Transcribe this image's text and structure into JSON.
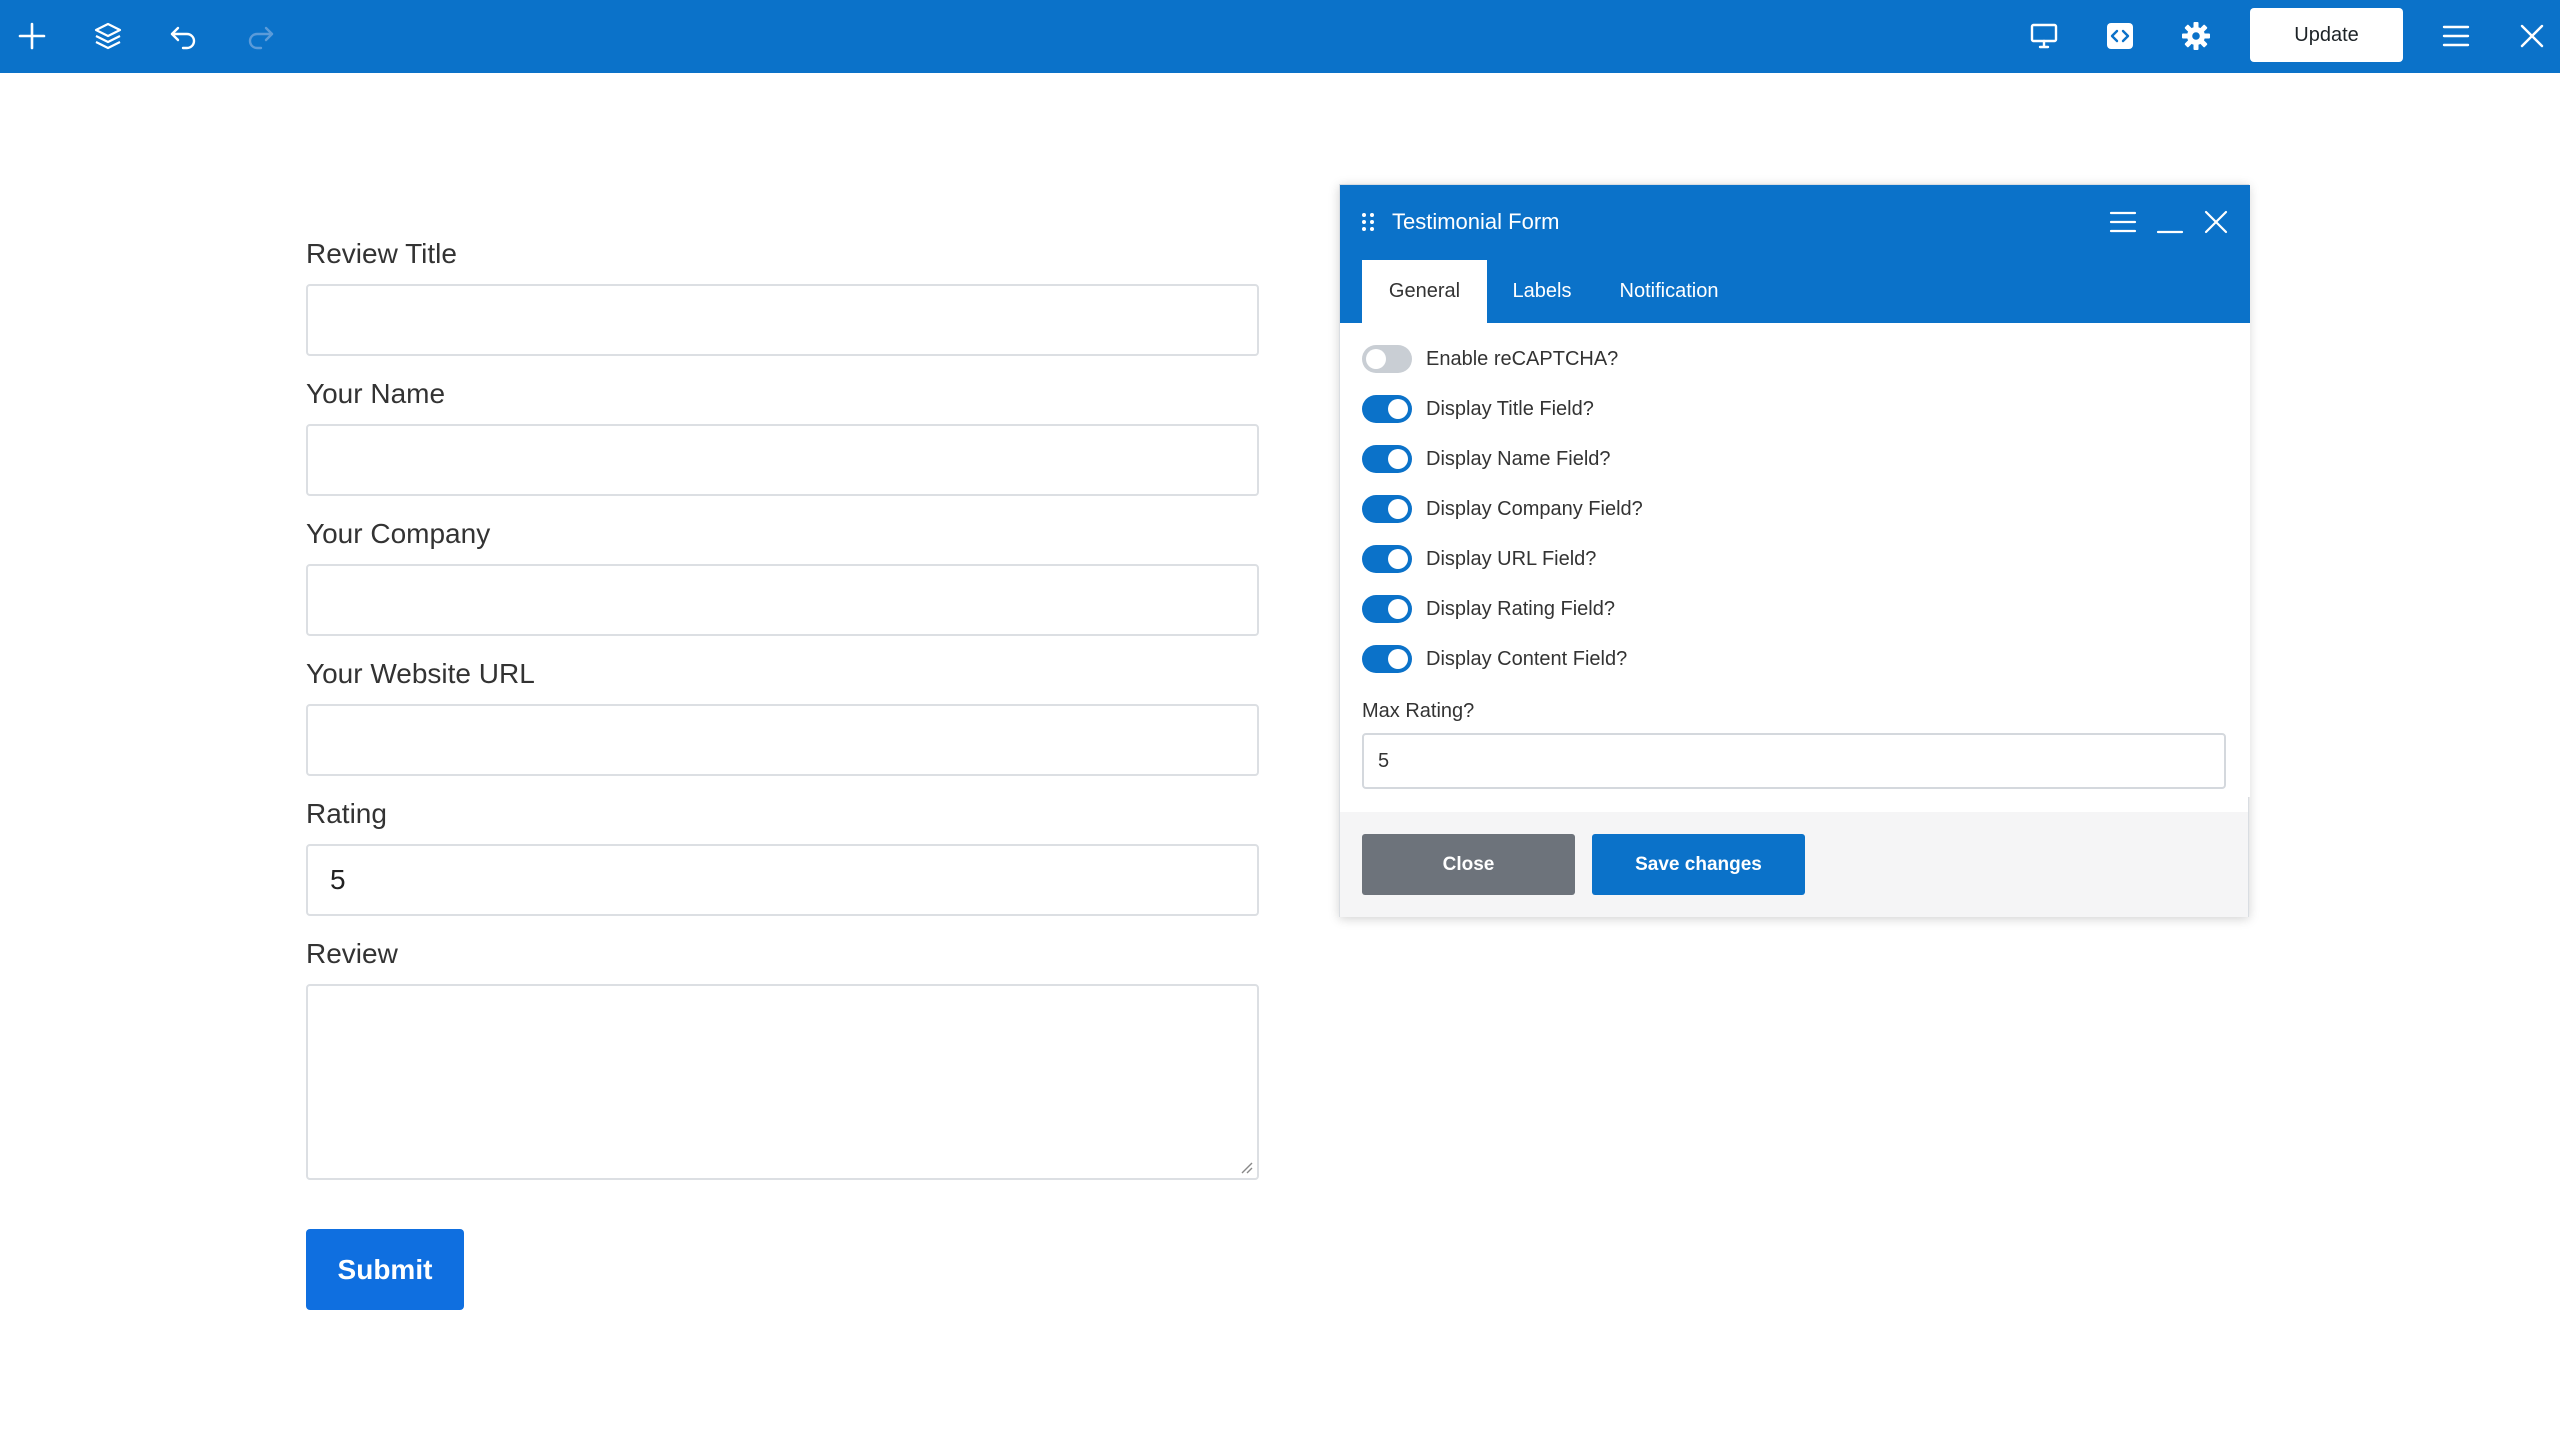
{
  "toolbar": {
    "icons_left": [
      "add-icon",
      "layers-icon",
      "undo-icon",
      "redo-icon"
    ],
    "icons_right": [
      "desktop-icon",
      "code-icon",
      "gear-icon",
      "hamburger-menu-icon",
      "close-icon"
    ],
    "update_label": "Update",
    "accent_color": "#0b72c9"
  },
  "form": {
    "fields": [
      {
        "label": "Review Title",
        "value": ""
      },
      {
        "label": "Your Name",
        "value": ""
      },
      {
        "label": "Your Company",
        "value": ""
      },
      {
        "label": "Your Website URL",
        "value": ""
      },
      {
        "label": "Rating",
        "value": "5"
      }
    ],
    "review_label": "Review",
    "submit_label": "Submit",
    "submit_color": "#0f6fe0"
  },
  "panel": {
    "title": "Testimonial Form",
    "tabs": [
      {
        "label": "General",
        "active": true
      },
      {
        "label": "Labels",
        "active": false
      },
      {
        "label": "Notification",
        "active": false
      }
    ],
    "toggles": [
      {
        "label": "Enable reCAPTCHA?",
        "on": false
      },
      {
        "label": "Display Title Field?",
        "on": true
      },
      {
        "label": "Display Name Field?",
        "on": true
      },
      {
        "label": "Display Company Field?",
        "on": true
      },
      {
        "label": "Display URL Field?",
        "on": true
      },
      {
        "label": "Display Rating Field?",
        "on": true
      },
      {
        "label": "Display Content Field?",
        "on": true
      }
    ],
    "max_rating_label": "Max Rating?",
    "max_rating_value": "5",
    "close_label": "Close",
    "save_label": "Save changes"
  }
}
